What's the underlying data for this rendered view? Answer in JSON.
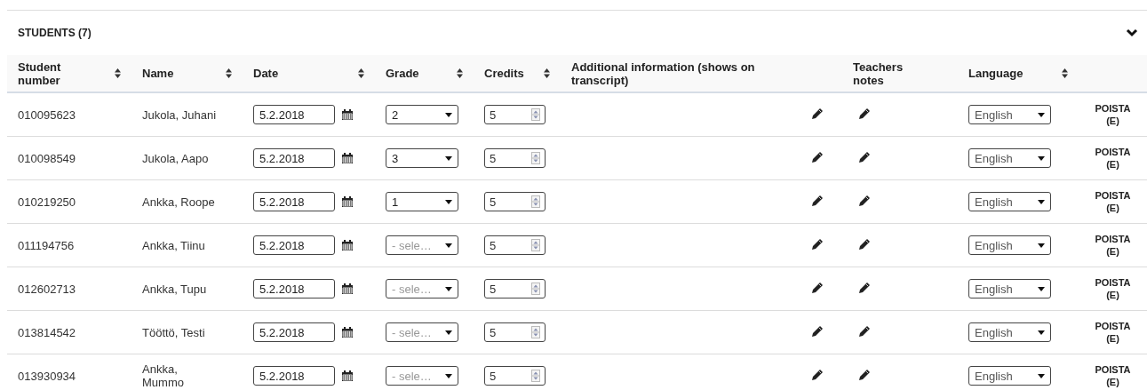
{
  "section": {
    "title": "STUDENTS (7)",
    "expanded": true
  },
  "columns": [
    {
      "label": "Student number",
      "sortable": true
    },
    {
      "label": "Name",
      "sortable": true
    },
    {
      "label": "Date",
      "sortable": true
    },
    {
      "label": "Grade",
      "sortable": true
    },
    {
      "label": "Credits",
      "sortable": true
    },
    {
      "label": "Additional information (shows on transcript)",
      "sortable": false
    },
    {
      "label": "Teachers notes",
      "sortable": false
    },
    {
      "label": "Language",
      "sortable": true
    }
  ],
  "rows": [
    {
      "number": "010095623",
      "name": "Jukola, Juhani",
      "date": "5.2.2018",
      "grade": {
        "value": "2"
      },
      "credits": "5",
      "language": "English",
      "action": "POISTA (E)"
    },
    {
      "number": "010098549",
      "name": "Jukola, Aapo",
      "date": "5.2.2018",
      "grade": {
        "value": "3"
      },
      "credits": "5",
      "language": "English",
      "action": "POISTA (E)"
    },
    {
      "number": "010219250",
      "name": "Ankka, Roope",
      "date": "5.2.2018",
      "grade": {
        "value": "1"
      },
      "credits": "5",
      "language": "English",
      "action": "POISTA (E)"
    },
    {
      "number": "011194756",
      "name": "Ankka, Tiinu",
      "date": "5.2.2018",
      "grade": {
        "placeholder": "- sele…"
      },
      "credits": "5",
      "language": "English",
      "action": "POISTA (E)"
    },
    {
      "number": "012602713",
      "name": "Ankka, Tupu",
      "date": "5.2.2018",
      "grade": {
        "placeholder": "- sele…"
      },
      "credits": "5",
      "language": "English",
      "action": "POISTA (E)"
    },
    {
      "number": "013814542",
      "name": "Tööttö, Testi",
      "date": "5.2.2018",
      "grade": {
        "placeholder": "- sele…"
      },
      "credits": "5",
      "language": "English",
      "action": "POISTA (E)"
    },
    {
      "number": "013930934",
      "name": "Ankka, Mummo",
      "date": "5.2.2018",
      "grade": {
        "placeholder": "- sele…"
      },
      "credits": "5",
      "language": "English",
      "action": "POISTA (E)"
    }
  ]
}
